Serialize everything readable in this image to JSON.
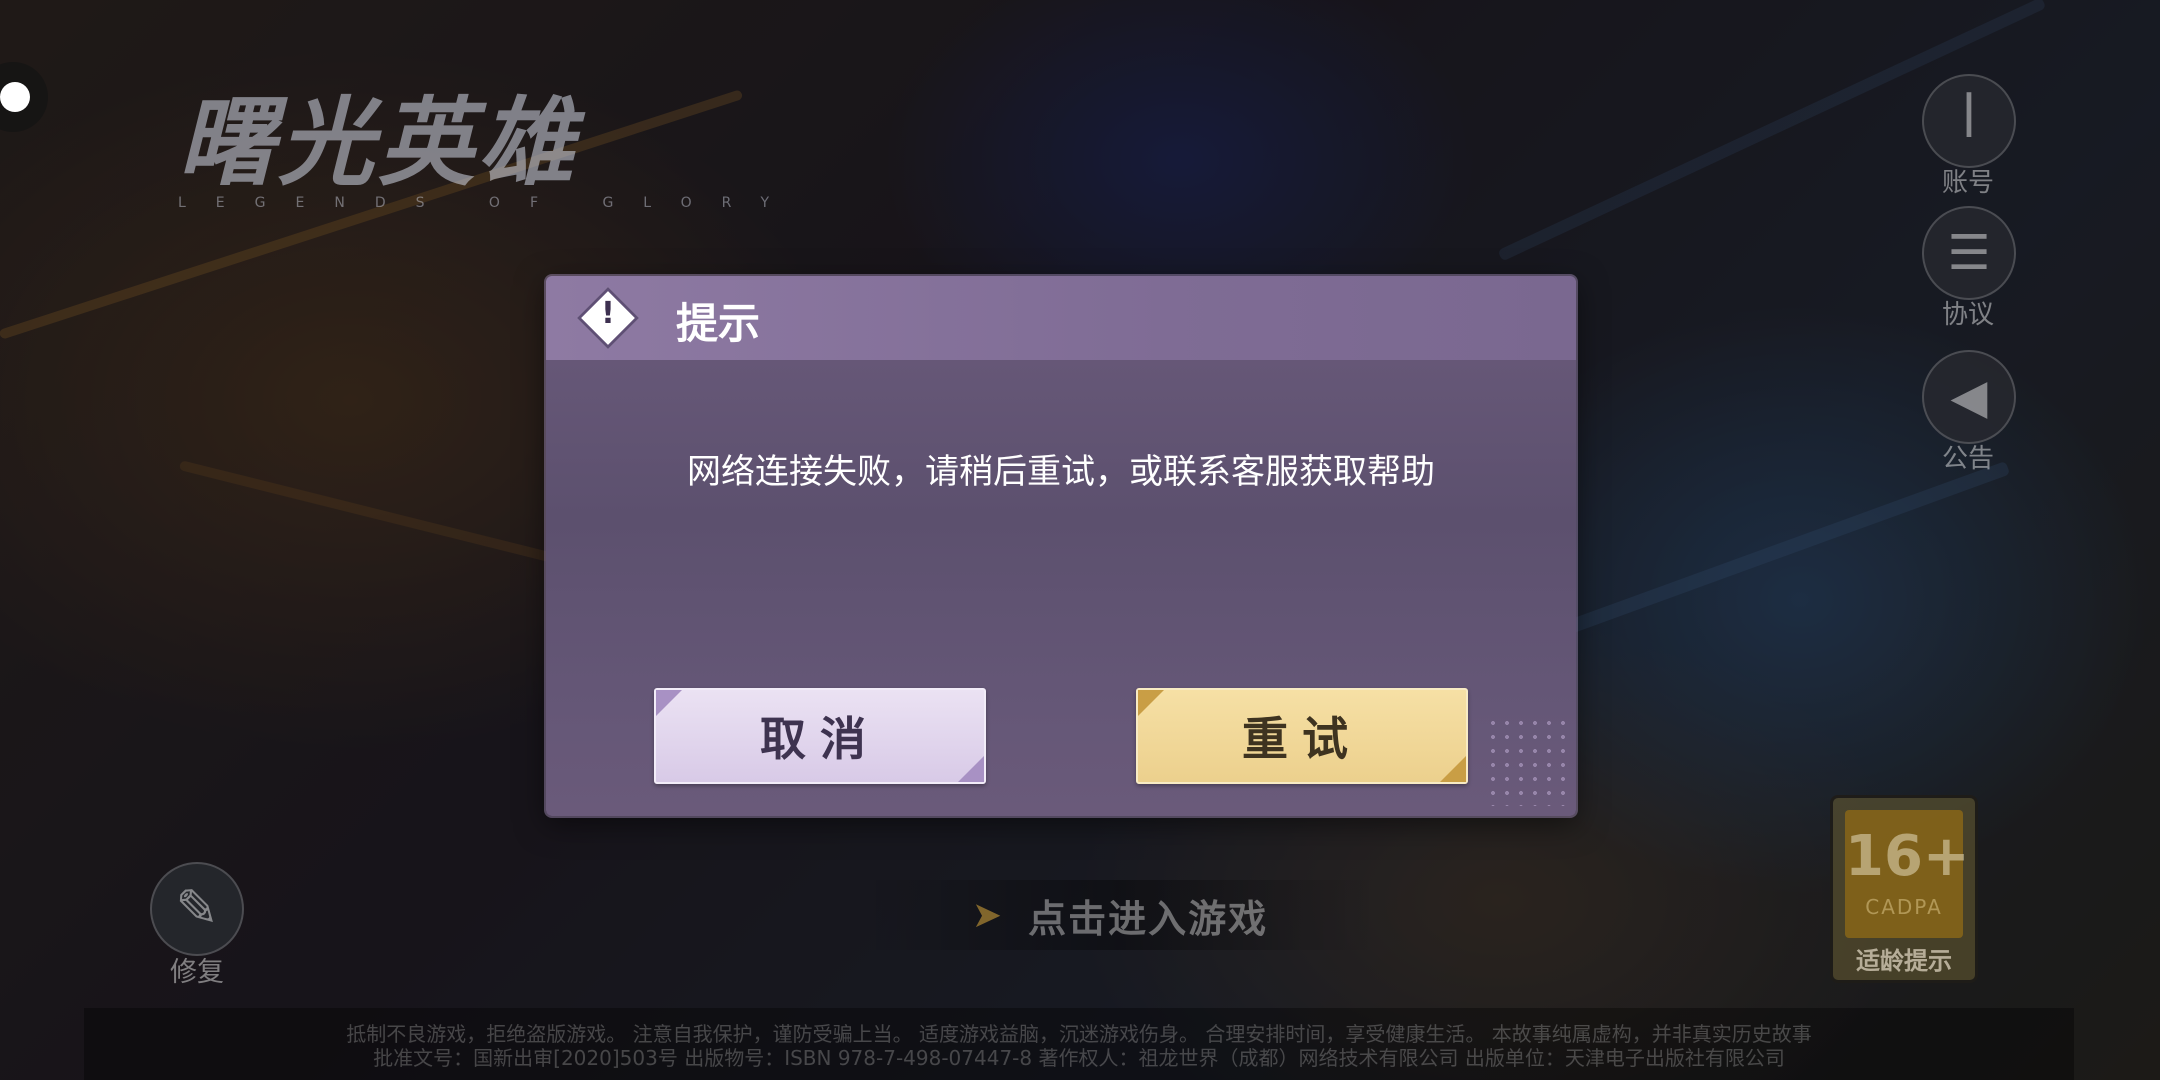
{
  "logo": {
    "title": "曙光英雄",
    "subtitle": "LEGENDS OF GLORY"
  },
  "side_buttons": [
    {
      "label": "账号",
      "icon": "account-icon"
    },
    {
      "label": "协议",
      "icon": "agreement-icon"
    },
    {
      "label": "公告",
      "icon": "announcement-icon"
    }
  ],
  "repair": {
    "label": "修复",
    "icon": "wrench-icon"
  },
  "enter_game": {
    "label": "点击进入游戏"
  },
  "age_rating": {
    "age": "16+",
    "org": "CADPA",
    "caption": "适龄提示"
  },
  "footer": {
    "line1": "抵制不良游戏，拒绝盗版游戏。 注意自我保护，谨防受骗上当。 适度游戏益脑，沉迷游戏伤身。 合理安排时间，享受健康生活。 本故事纯属虚构，并非真实历史故事",
    "line2": "批准文号：国新出审[2020]503号 出版物号：ISBN 978-7-498-07447-8 著作权人：祖龙世界（成都）网络技术有限公司 出版单位：天津电子出版社有限公司"
  },
  "dialog": {
    "title": "提示",
    "message": "网络连接失败，请稍后重试，或联系客服获取帮助",
    "cancel_label": "取消",
    "retry_label": "重试"
  }
}
